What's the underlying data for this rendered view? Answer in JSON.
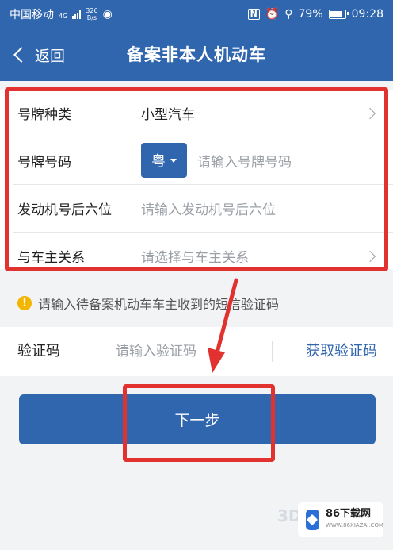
{
  "status_bar": {
    "carrier": "中国移动",
    "network": "4G",
    "speed_value": "326",
    "speed_unit": "B/s",
    "battery": "79%",
    "time": "09:28"
  },
  "nav": {
    "back_label": "返回",
    "title": "备案非本人机动车"
  },
  "form": {
    "plate_type": {
      "label": "号牌种类",
      "value": "小型汽车"
    },
    "plate_number": {
      "label": "号牌号码",
      "province": "粤",
      "placeholder": "请输入号牌号码"
    },
    "engine": {
      "label": "发动机号后六位",
      "placeholder": "请输入发动机号后六位"
    },
    "relation": {
      "label": "与车主关系",
      "placeholder": "请选择与车主关系"
    }
  },
  "tip": {
    "icon": "!",
    "text": "请输入待备案机动车车主收到的短信验证码"
  },
  "verify": {
    "label": "验证码",
    "placeholder": "请输入验证码",
    "get_code": "获取验证码"
  },
  "next_button": "下一步",
  "watermark": {
    "brand": "86下载网",
    "brand_sub": "WWW.86XIAZAI.COM",
    "corner_text": "3D"
  },
  "annotation_color": "#e2322f",
  "accent_color": "#2f66ad"
}
